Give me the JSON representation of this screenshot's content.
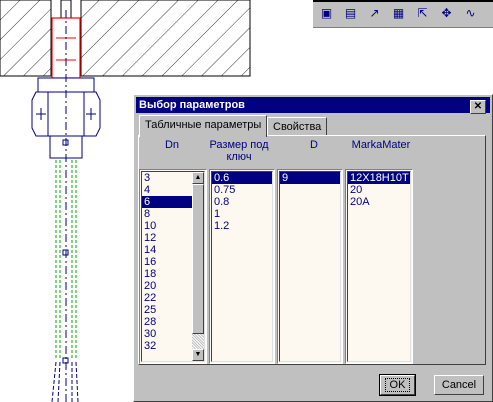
{
  "dialog": {
    "title": "Выбор параметров",
    "close_glyph": "✕",
    "tabs": [
      {
        "label": "Табличные параметры",
        "active": true
      },
      {
        "label": "Свойства",
        "active": false
      }
    ],
    "columns": [
      {
        "header": "Dn",
        "items": [
          "3",
          "4",
          "6",
          "8",
          "10",
          "12",
          "14",
          "16",
          "18",
          "20",
          "22",
          "25",
          "28",
          "30",
          "32"
        ],
        "selected": 2
      },
      {
        "header": "Размер под ключ",
        "items": [
          "0.6",
          "0.75",
          "0.8",
          "1",
          "1.2"
        ],
        "selected": 0
      },
      {
        "header": "D",
        "items": [
          "9"
        ],
        "selected": 0
      },
      {
        "header": "MarkaMater",
        "items": [
          "12X18H10T",
          "20",
          "20A"
        ],
        "selected": 0
      }
    ],
    "ok_label": "OK",
    "cancel_label": "Cancel"
  },
  "toolbar": {
    "icons": [
      "save-icon",
      "table-icon",
      "chart-icon",
      "document-icon",
      "select-icon",
      "move-icon",
      "curve-icon"
    ]
  },
  "colors": {
    "title_bar": "#000080",
    "selection": "#000080",
    "list_bg": "#fdf8f0",
    "drawing_line": "#000080",
    "axis_line": "#00aa00",
    "part_highlight": "#ff0000"
  }
}
